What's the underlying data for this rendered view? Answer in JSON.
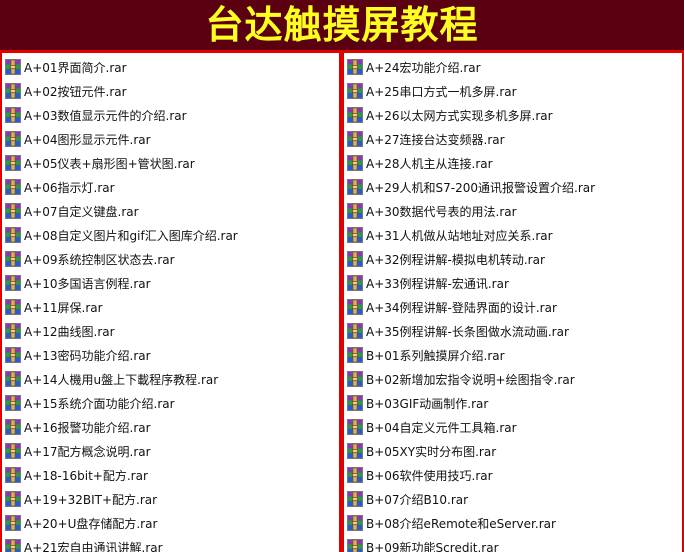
{
  "banner": {
    "title": "台达触摸屏教程"
  },
  "colors": {
    "banner_bg": "#5a0010",
    "title_text": "#ffff22",
    "border_red": "#e00000"
  },
  "icon": "rar-archive-icon",
  "left_files": [
    "A+01界面简介.rar",
    "A+02按钮元件.rar",
    "A+03数值显示元件的介绍.rar",
    "A+04图形显示元件.rar",
    "A+05仪表+扇形图+管状图.rar",
    "A+06指示灯.rar",
    "A+07自定义键盘.rar",
    "A+08自定义图片和gif汇入图库介绍.rar",
    "A+09系统控制区状态去.rar",
    "A+10多国语言例程.rar",
    "A+11屏保.rar",
    "A+12曲线图.rar",
    "A+13密码功能介绍.rar",
    "A+14人機用u盤上下載程序教程.rar",
    "A+15系统介面功能介绍.rar",
    "A+16报警功能介绍.rar",
    "A+17配方概念说明.rar",
    "A+18-16bit+配方.rar",
    "A+19+32BIT+配方.rar",
    "A+20+U盘存储配方.rar",
    "A+21宏自由通讯讲解.rar"
  ],
  "right_files": [
    "A+24宏功能介绍.rar",
    "A+25串口方式一机多屏.rar",
    "A+26以太网方式实现多机多屏.rar",
    "A+27连接台达变频器.rar",
    "A+28人机主从连接.rar",
    "A+29人机和S7-200通讯报警设置介绍.rar",
    "A+30数据代号表的用法.rar",
    "A+31人机做从站地址对应关系.rar",
    "A+32例程讲解-模拟电机转动.rar",
    "A+33例程讲解-宏通讯.rar",
    "A+34例程讲解-登陆界面的设计.rar",
    "A+35例程讲解-长条图做水流动画.rar",
    "B+01系列触摸屏介绍.rar",
    "B+02新增加宏指令说明+绘图指令.rar",
    "B+03GIF动画制作.rar",
    "B+04自定义元件工具箱.rar",
    "B+05XY实时分布图.rar",
    "B+06软件使用技巧.rar",
    "B+07介绍B10.rar",
    "B+08介绍eRemote和eServer.rar",
    "B+09新功能Scredit.rar"
  ]
}
